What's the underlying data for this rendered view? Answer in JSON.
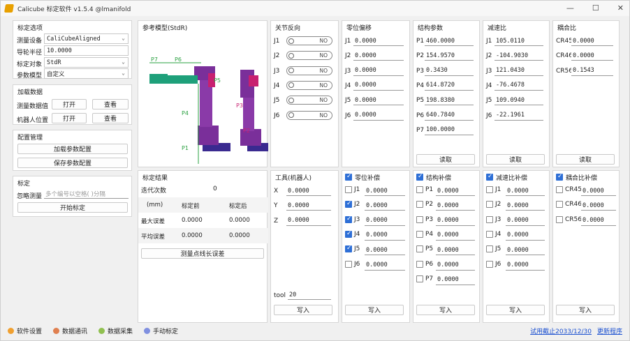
{
  "title": "Calicube 标定软件 v1.5.4 @lmanifold",
  "window": {
    "min": "—",
    "max": "☐",
    "close": "✕"
  },
  "options": {
    "title": "标定选项",
    "device_label": "测量设备",
    "device_value": "CaliCubeAligned",
    "radius_label": "导轮半径",
    "radius_value": "10.0000",
    "target_label": "标定对象",
    "target_value": "StdR",
    "ptype_label": "参数模型",
    "ptype_value": "自定义"
  },
  "load": {
    "title": "加载数据",
    "meas_label": "测量数据值",
    "robot_label": "机器人位置",
    "open": "打开",
    "view": "查看"
  },
  "config": {
    "title": "配置管理",
    "load_btn": "加载参数配置",
    "save_btn": "保存参数配置"
  },
  "calib": {
    "title": "标定",
    "ignore_label": "忽略测量",
    "ignore_placeholder": "多个编号以空格( )分隔",
    "start_btn": "开始标定"
  },
  "model": {
    "title": "参考模型(StdR)",
    "labels": [
      "P7",
      "P6",
      "P5",
      "P4",
      "P1",
      "P3",
      "P2"
    ]
  },
  "result": {
    "title": "标定结果",
    "iter_label": "迭代次数",
    "iter_value": "0",
    "headers": [
      "(mm)",
      "标定前",
      "标定后"
    ],
    "rows": [
      {
        "name": "最大误差",
        "before": "0.0000",
        "after": "0.0000"
      },
      {
        "name": "平均误差",
        "before": "0.0000",
        "after": "0.0000"
      }
    ],
    "btn": "测量点线长误差"
  },
  "joint_dir": {
    "title": "关节反向",
    "items": [
      {
        "label": "J1",
        "state": "NO"
      },
      {
        "label": "J2",
        "state": "NO"
      },
      {
        "label": "J3",
        "state": "NO"
      },
      {
        "label": "J4",
        "state": "NO"
      },
      {
        "label": "J5",
        "state": "NO"
      },
      {
        "label": "J6",
        "state": "NO"
      }
    ]
  },
  "zero": {
    "title": "零位偏移",
    "items": [
      {
        "label": "J1",
        "value": "0.0000"
      },
      {
        "label": "J2",
        "value": "0.0000"
      },
      {
        "label": "J3",
        "value": "0.0000"
      },
      {
        "label": "J4",
        "value": "0.0000"
      },
      {
        "label": "J5",
        "value": "0.0000"
      },
      {
        "label": "J6",
        "value": "0.0000"
      }
    ]
  },
  "struct": {
    "title": "结构参数",
    "items": [
      {
        "label": "P1",
        "value": "460.0000"
      },
      {
        "label": "P2",
        "value": "154.9570"
      },
      {
        "label": "P3",
        "value": "0.3430"
      },
      {
        "label": "P4",
        "value": "614.8720"
      },
      {
        "label": "P5",
        "value": "198.8380"
      },
      {
        "label": "P6",
        "value": "640.7840"
      },
      {
        "label": "P7",
        "value": "100.0000"
      }
    ],
    "read": "读取"
  },
  "ratio": {
    "title": "减速比",
    "items": [
      {
        "label": "J1",
        "value": "105.0110"
      },
      {
        "label": "J2",
        "value": "-104.9030"
      },
      {
        "label": "J3",
        "value": "121.0430"
      },
      {
        "label": "J4",
        "value": "-76.4678"
      },
      {
        "label": "J5",
        "value": "109.0940"
      },
      {
        "label": "J6",
        "value": "-22.1961"
      }
    ],
    "read": "读取"
  },
  "couple": {
    "title": "耦合比",
    "items": [
      {
        "label": "CR45",
        "value": "0.0000"
      },
      {
        "label": "CR46",
        "value": "0.0000"
      },
      {
        "label": "CR56",
        "value": "0.1543"
      }
    ],
    "read": "读取"
  },
  "tool": {
    "title": "工具(机器人)",
    "items": [
      {
        "label": "X",
        "value": "0.0000"
      },
      {
        "label": "Y",
        "value": "0.0000"
      },
      {
        "label": "Z",
        "value": "0.0000"
      }
    ],
    "tool_label": "tool",
    "tool_value": "20",
    "write": "写入"
  },
  "zero_comp": {
    "title": "零位补偿",
    "items": [
      {
        "label": "J1",
        "value": "0.0000",
        "on": false
      },
      {
        "label": "J2",
        "value": "0.0000",
        "on": true
      },
      {
        "label": "J3",
        "value": "0.0000",
        "on": true
      },
      {
        "label": "J4",
        "value": "0.0000",
        "on": true
      },
      {
        "label": "J5",
        "value": "0.0000",
        "on": true
      },
      {
        "label": "J6",
        "value": "0.0000",
        "on": false
      }
    ],
    "write": "写入"
  },
  "struct_comp": {
    "title": "结构补偿",
    "items": [
      {
        "label": "P1",
        "value": "0.0000"
      },
      {
        "label": "P2",
        "value": "0.0000"
      },
      {
        "label": "P3",
        "value": "0.0000"
      },
      {
        "label": "P4",
        "value": "0.0000"
      },
      {
        "label": "P5",
        "value": "0.0000"
      },
      {
        "label": "P6",
        "value": "0.0000"
      },
      {
        "label": "P7",
        "value": "0.0000"
      }
    ],
    "write": "写入"
  },
  "ratio_comp": {
    "title": "减速比补偿",
    "items": [
      {
        "label": "J1",
        "value": "0.0000"
      },
      {
        "label": "J2",
        "value": "0.0000"
      },
      {
        "label": "J3",
        "value": "0.0000"
      },
      {
        "label": "J4",
        "value": "0.0000"
      },
      {
        "label": "J5",
        "value": "0.0000"
      },
      {
        "label": "J6",
        "value": "0.0000"
      }
    ],
    "write": "写入"
  },
  "couple_comp": {
    "title": "耦合比补偿",
    "items": [
      {
        "label": "CR45",
        "value": "0.0000"
      },
      {
        "label": "CR46",
        "value": "0.0000"
      },
      {
        "label": "CR56",
        "value": "0.0000"
      }
    ],
    "write": "写入"
  },
  "status": {
    "tabs": [
      {
        "label": "软件设置",
        "color": "#f0a030"
      },
      {
        "label": "数据通讯",
        "color": "#e08050"
      },
      {
        "label": "数据采集",
        "color": "#90c050"
      },
      {
        "label": "手动标定",
        "color": "#8090e0"
      }
    ],
    "trial": "试用截止2033/12/30",
    "update": "更新程序"
  }
}
